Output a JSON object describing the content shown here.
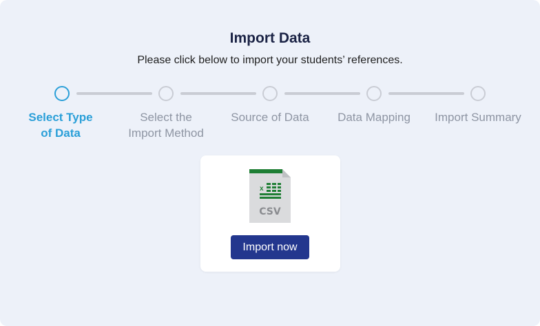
{
  "header": {
    "title": "Import Data",
    "subtitle": "Please click below to import your students’ references."
  },
  "stepper": {
    "active_color": "#2a9fd8",
    "inactive_color": "#8e95a3",
    "steps": [
      {
        "line1": "Select Type",
        "line2": "of Data",
        "active": true
      },
      {
        "line1": "Select the",
        "line2": "Import Method",
        "active": false
      },
      {
        "line1": "Source of Data",
        "line2": "",
        "active": false
      },
      {
        "line1": "Data Mapping",
        "line2": "",
        "active": false
      },
      {
        "line1": "Import Summary",
        "line2": "",
        "active": false
      }
    ]
  },
  "card": {
    "file_icon": "csv-file-icon",
    "file_label": "CSV",
    "import_button": "Import now",
    "button_color": "#23378e"
  }
}
